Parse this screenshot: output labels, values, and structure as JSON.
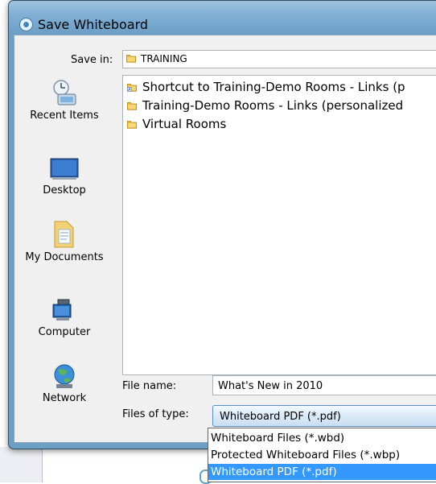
{
  "window": {
    "title": "Save Whiteboard"
  },
  "save_in": {
    "label": "Save in:",
    "value": "TRAINING"
  },
  "places": [
    {
      "label": "Recent Items",
      "icon": "recent-items-icon"
    },
    {
      "label": "Desktop",
      "icon": "desktop-icon"
    },
    {
      "label": "My Documents",
      "icon": "my-documents-icon"
    },
    {
      "label": "Computer",
      "icon": "computer-icon"
    },
    {
      "label": "Network",
      "icon": "network-icon"
    }
  ],
  "files": [
    {
      "name": "Shortcut to Training-Demo Rooms - Links (p",
      "icon": "folder-shortcut-icon"
    },
    {
      "name": "Training-Demo Rooms - Links (personalized",
      "icon": "folder-icon"
    },
    {
      "name": "Virtual Rooms",
      "icon": "folder-icon"
    }
  ],
  "file_name": {
    "label": "File name:",
    "value": "What's New in 2010"
  },
  "file_type": {
    "label": "Files of type:",
    "value": "Whiteboard PDF (*.pdf)",
    "options": [
      "Whiteboard Files (*.wbd)",
      "Protected Whiteboard Files (*.wbp)",
      "Whiteboard PDF (*.pdf)"
    ],
    "selected_index": 2
  },
  "colors": {
    "title_bar": "#7eaed4",
    "selection": "#3399ff",
    "folder": "#e8b83a"
  }
}
